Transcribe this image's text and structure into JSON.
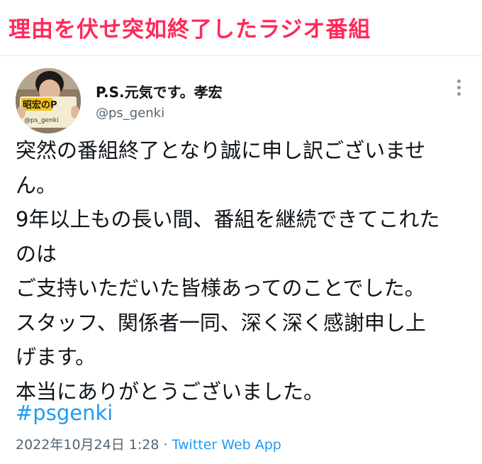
{
  "banner": {
    "title": "理由を伏せ突如終了したラジオ番組"
  },
  "tweet": {
    "author": {
      "display_name": "P.S.元気です。孝宏",
      "handle": "@ps_genki",
      "avatar_sign": {
        "text": "昭宏のP",
        "subtext": "@ps_genki"
      }
    },
    "more_icon": "more-vertical-icon",
    "body_lines": [
      "突然の番組終了となり誠に申し訳ございませ",
      "ん。",
      "9年以上もの長い間、番組を継続できてこれた",
      "のは",
      "ご支持いただいた皆様あってのことでした。",
      "スタッフ、関係者一同、深く深く感謝申し上",
      "げます。",
      "本当にありがとうございました。"
    ],
    "hashtag": "#psgenki",
    "timestamp": "2022年10月24日 1:28",
    "separator": " · ",
    "source": "Twitter Web App"
  },
  "colors": {
    "banner_title": "#ff2a5a",
    "link": "#1d9bf0",
    "secondary_text": "#536471",
    "primary_text": "#0f1419"
  }
}
